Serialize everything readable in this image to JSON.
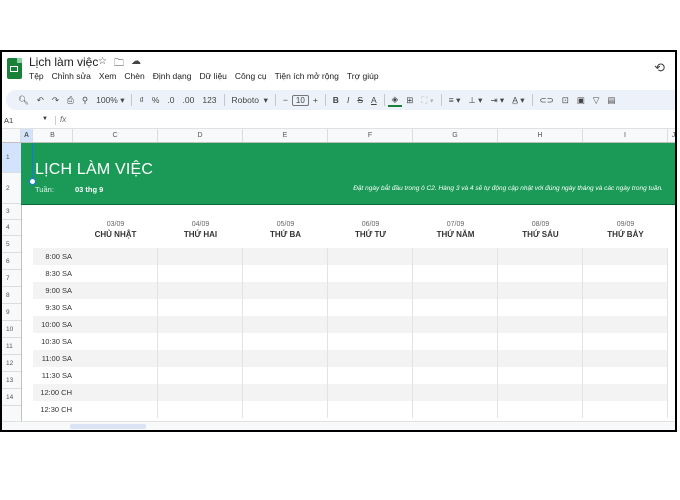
{
  "app": {
    "doc_title": "Lịch làm việc",
    "title_icons": [
      "star-icon",
      "folder-icon",
      "cloud-icon"
    ],
    "history_icon": "history-icon"
  },
  "menu": [
    "Tệp",
    "Chỉnh sửa",
    "Xem",
    "Chèn",
    "Định dạng",
    "Dữ liệu",
    "Công cụ",
    "Tiện ích mở rộng",
    "Trợ giúp"
  ],
  "toolbar": {
    "zoom": "100%",
    "currency": "₫",
    "percent": "%",
    "dec_decrease": ".0",
    "dec_increase": ".00",
    "number_format": "123",
    "font": "Roboto",
    "font_size": "10",
    "bold": "B",
    "italic": "I",
    "strike": "S",
    "text_color": "A"
  },
  "formula_bar": {
    "name_box": "A1",
    "fx": "fx",
    "value": ""
  },
  "columns": [
    "A",
    "B",
    "C",
    "D",
    "E",
    "F",
    "G",
    "H",
    "I",
    "J"
  ],
  "rows": [
    "1",
    "2",
    "3",
    "4",
    "5",
    "6",
    "7",
    "8",
    "9",
    "10",
    "11",
    "12",
    "13",
    "14"
  ],
  "banner": {
    "title": "LỊCH LÀM VIỆC",
    "week_label": "Tuần:",
    "week_value": "03 thg 9",
    "note": "Đặt ngày bắt đầu trong ô C2. Hàng 3 và 4 sẽ tự động cập nhật với đúng ngày tháng và các ngày trong tuần."
  },
  "days": [
    {
      "date": "03/09",
      "name": "CHỦ NHẬT"
    },
    {
      "date": "04/09",
      "name": "THỨ HAI"
    },
    {
      "date": "05/09",
      "name": "THỨ BA"
    },
    {
      "date": "06/09",
      "name": "THỨ TƯ"
    },
    {
      "date": "07/09",
      "name": "THỨ NĂM"
    },
    {
      "date": "08/09",
      "name": "THỨ SÁU"
    },
    {
      "date": "09/09",
      "name": "THỨ BẢY"
    }
  ],
  "times": [
    "8:00 SA",
    "8:30 SA",
    "9:00 SA",
    "9:30 SA",
    "10:00 SA",
    "10:30 SA",
    "11:00 SA",
    "11:30 SA",
    "12:00 CH",
    "12:30 CH"
  ]
}
